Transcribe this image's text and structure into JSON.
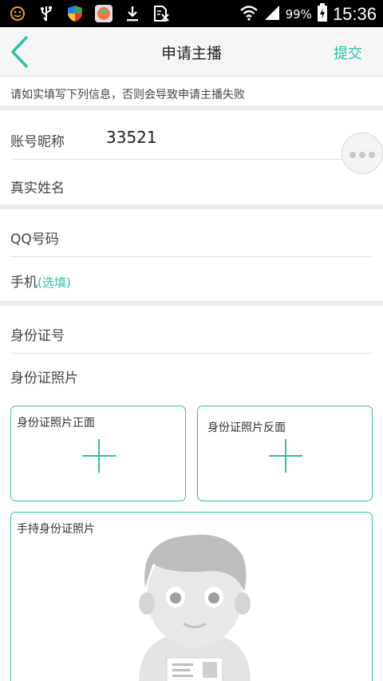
{
  "status_bar": {
    "battery_percent": "99%",
    "time": "15:36",
    "icons": [
      "smiley-icon",
      "usb-icon",
      "shield-app-icon",
      "game-app-icon",
      "download-icon",
      "no-sim-icon",
      "wifi-icon",
      "signal-icon",
      "battery-charging-icon"
    ]
  },
  "header": {
    "title": "申请主播",
    "submit_label": "提交",
    "back_icon": "chevron-left-icon"
  },
  "notice": "请如实填写下列信息，否则会导致申请主播失败",
  "form": {
    "nickname_label": "账号昵称",
    "nickname_value": "33521",
    "real_name_label": "真实姓名",
    "qq_label": "QQ号码",
    "phone_label": "手机",
    "phone_hint": "(选填)",
    "id_number_label": "身份证号",
    "id_photo_label": "身份证照片",
    "id_front_label": "身份证照片正面",
    "id_back_label": "身份证照片反面",
    "id_holding_label": "手持身份证照片"
  },
  "colors": {
    "accent": "#2ec2a6",
    "nav_bg": "#f6f6f6",
    "separator": "#ececec",
    "placeholder_art": "#c9c9c9"
  }
}
